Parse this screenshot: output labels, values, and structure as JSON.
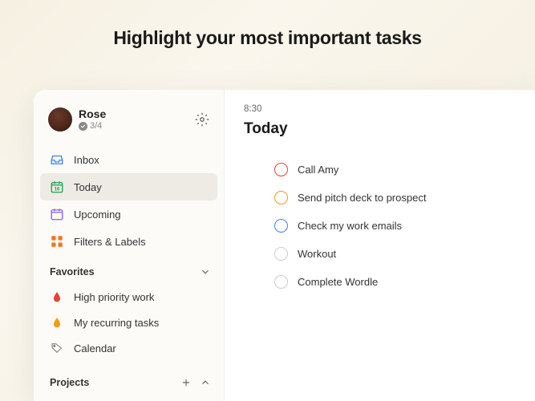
{
  "hero": {
    "title": "Highlight your most important tasks"
  },
  "profile": {
    "name": "Rose",
    "progress": "3/4"
  },
  "nav": {
    "inbox": "Inbox",
    "today": "Today",
    "upcoming": "Upcoming",
    "filters": "Filters & Labels"
  },
  "sections": {
    "favorites": {
      "label": "Favorites",
      "items": [
        {
          "label": "High priority work",
          "color": "red"
        },
        {
          "label": "My recurring tasks",
          "color": "orange"
        },
        {
          "label": "Calendar",
          "type": "tag"
        }
      ]
    },
    "projects": {
      "label": "Projects"
    }
  },
  "main": {
    "time": "8:30",
    "title": "Today",
    "tasks": [
      {
        "priority": "p1",
        "label": "Call Amy"
      },
      {
        "priority": "p2",
        "label": "Send pitch deck to prospect"
      },
      {
        "priority": "p3",
        "label": "Check my work emails"
      },
      {
        "priority": "",
        "label": "Workout"
      },
      {
        "priority": "",
        "label": "Complete Wordle"
      }
    ]
  }
}
